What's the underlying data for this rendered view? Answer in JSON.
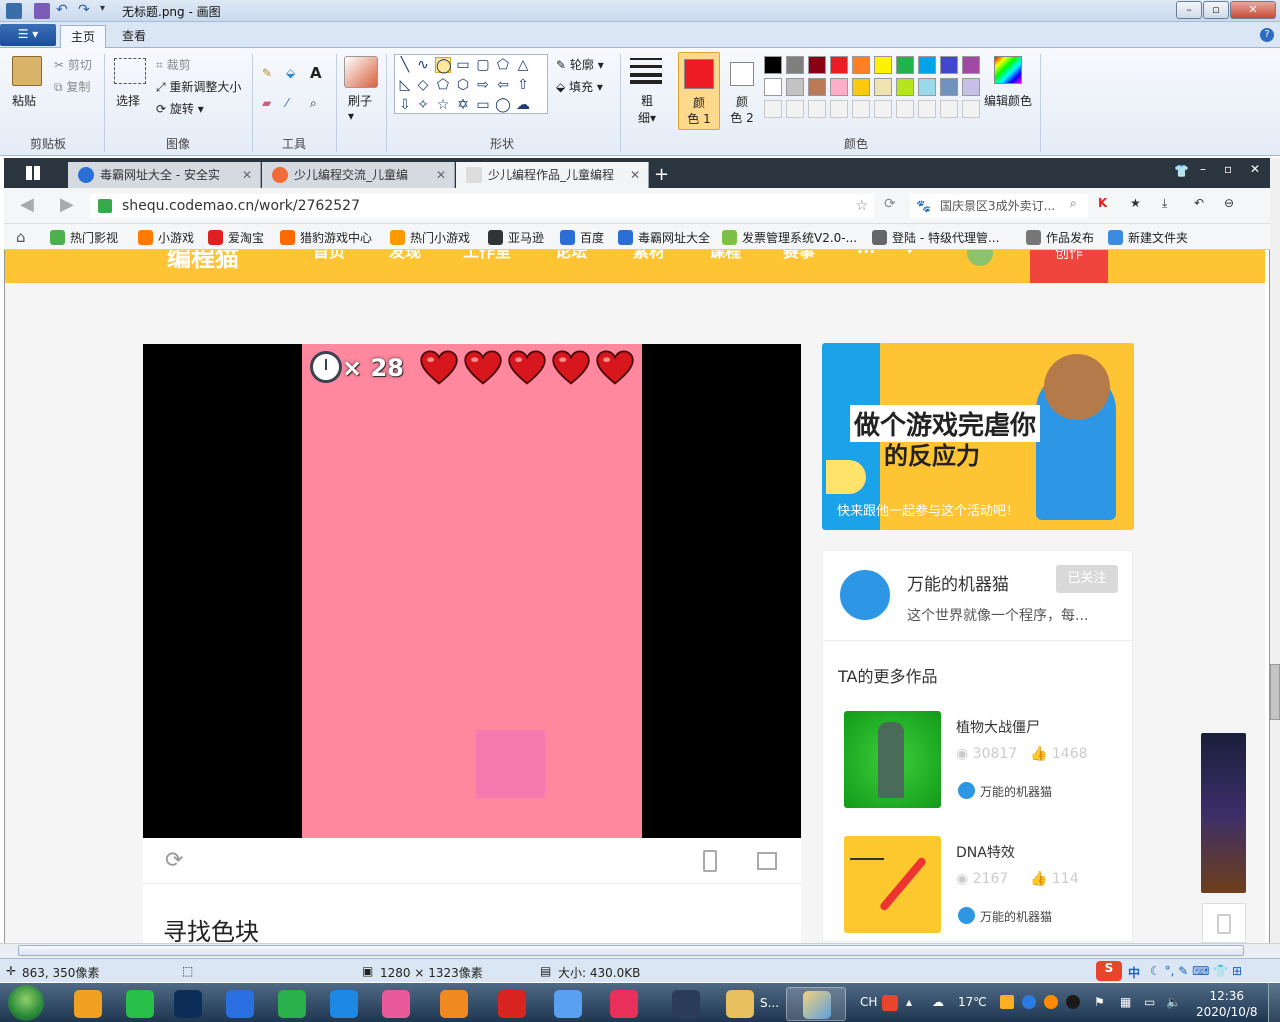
{
  "paint": {
    "title": "无标题.png - 画图",
    "tabs": {
      "home": "主页",
      "view": "查看"
    },
    "clipboard": {
      "paste": "粘贴",
      "cut": "剪切",
      "copy": "复制",
      "group": "剪贴板"
    },
    "image": {
      "select": "选择",
      "crop": "裁剪",
      "resize": "重新调整大小",
      "rotate": "旋转",
      "group": "图像"
    },
    "tools": {
      "group": "工具"
    },
    "brush": {
      "label": "刷子"
    },
    "shapes": {
      "outline": "轮廓",
      "fill": "填充",
      "group": "形状"
    },
    "size": {
      "label1": "粗",
      "label2": "细"
    },
    "color1": {
      "label1": "颜",
      "label2": "色 1"
    },
    "color2": {
      "label1": "颜",
      "label2": "色 2"
    },
    "colors": {
      "group": "颜色",
      "edit": "编辑颜色"
    },
    "palette": [
      "#000000",
      "#7f7f7f",
      "#880015",
      "#ed1c24",
      "#ff7f27",
      "#fff200",
      "#22b14c",
      "#00a2e8",
      "#3f48cc",
      "#a349a4",
      "#ffffff",
      "#c3c3c3",
      "#b97a57",
      "#ffaec9",
      "#ffc90e",
      "#efe4b0",
      "#b5e61d",
      "#99d9ea",
      "#7092be",
      "#c8bfe7"
    ],
    "status": {
      "cursor": "863, 350像素",
      "dimensions": "1280 × 1323像素",
      "filesize": "大小: 430.0KB"
    }
  },
  "browser": {
    "tabs": [
      {
        "label": "毒霸网址大全 - 安全实",
        "active": false
      },
      {
        "label": "少儿编程交流_儿童编",
        "active": false
      },
      {
        "label": "少儿编程作品_儿童编程",
        "active": true
      }
    ],
    "url": "shequ.codemao.cn/work/2762527",
    "search": "国庆景区3成外卖订...",
    "bookmarks": [
      "热门影视",
      "小游戏",
      "爱淘宝",
      "猎豹游戏中心",
      "热门小游戏",
      "亚马逊",
      "百度",
      "毒霸网址大全",
      "发票管理系统V2.0-...",
      "登陆 - 特级代理管...",
      "作品发布",
      "新建文件夹"
    ],
    "bookmark_colors": [
      "#4caf50",
      "#ff7a00",
      "#e02020",
      "#ff6a00",
      "#ff9900",
      "#333333",
      "#2b6fd6",
      "#2b6fd6",
      "#7cc04a",
      "#666666",
      "#777777",
      "#3b8be0"
    ]
  },
  "site": {
    "brand": "编程猫",
    "nav": [
      "首页",
      "发现",
      "工作室",
      "论坛",
      "素材",
      "课程",
      "赛事",
      "..."
    ],
    "create": "创作",
    "game": {
      "timer_count": "× 28",
      "lives": 5
    },
    "work_title": "寻找色块",
    "banner": {
      "line1": "做个游戏完虐你",
      "line2": "的反应力",
      "sub": "快来跟他一起参与这个活动吧！"
    },
    "author": {
      "name": "万能的机器猫",
      "follow": "已关注",
      "bio": "这个世界就像一个程序，每..."
    },
    "more_works_heading": "TA的更多作品",
    "works": [
      {
        "title": "植物大战僵尸",
        "views": "30817",
        "likes": "1468",
        "author": "万能的机器猫"
      },
      {
        "title": "DNA特效",
        "views": "2167",
        "likes": "114",
        "author": "万能的机器猫"
      }
    ]
  },
  "taskbar": {
    "lang": "CH",
    "weather": "17℃",
    "time": "12:36",
    "date": "2020/10/8",
    "running": "S...",
    "ime": "中"
  }
}
